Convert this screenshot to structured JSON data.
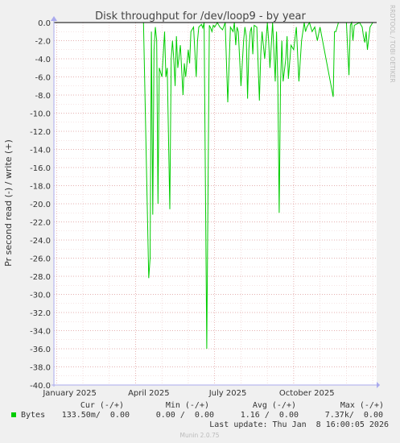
{
  "chart_data": {
    "type": "line",
    "title": "Disk throughput for /dev/loop9 - by year",
    "ylabel": "Pr second read (-) / write (+)",
    "side_label": "RRDTOOL / TOBI OETIKER",
    "ylim": [
      -40,
      0
    ],
    "y_ticks": [
      "0.0",
      "-2.0",
      "-4.0",
      "-6.0",
      "-8.0",
      "-10.0",
      "-12.0",
      "-14.0",
      "-16.0",
      "-18.0",
      "-20.0",
      "-22.0",
      "-24.0",
      "-26.0",
      "-28.0",
      "-30.0",
      "-32.0",
      "-34.0",
      "-36.0",
      "-38.0",
      "-40.0"
    ],
    "x_labels": [
      "January 2025",
      "April 2025",
      "July 2025",
      "October 2025"
    ],
    "series_color": "#00cc00",
    "series": [
      {
        "name": "Bytes",
        "x_months": [
          0.0,
          3.3,
          3.5,
          3.55,
          3.6,
          3.65,
          3.7,
          3.75,
          3.8,
          3.85,
          3.9,
          4.0,
          4.1,
          4.15,
          4.2,
          4.3,
          4.35,
          4.4,
          4.45,
          4.5,
          4.55,
          4.6,
          4.7,
          4.8,
          4.85,
          4.9,
          5.0,
          5.05,
          5.1,
          5.2,
          5.3,
          5.35,
          5.4,
          5.5,
          5.55,
          5.6,
          5.7,
          5.8,
          5.85,
          5.9,
          5.95,
          6.0,
          6.1,
          6.2,
          6.3,
          6.4,
          6.5,
          6.6,
          6.7,
          6.75,
          6.8,
          6.85,
          6.9,
          7.0,
          7.1,
          7.15,
          7.2,
          7.25,
          7.3,
          7.35,
          7.4,
          7.45,
          7.5,
          7.6,
          7.7,
          7.75,
          7.8,
          7.9,
          8.0,
          8.05,
          8.1,
          8.2,
          8.3,
          8.35,
          8.4,
          8.45,
          8.5,
          8.55,
          8.6,
          8.7,
          8.75,
          8.8,
          8.9,
          9.0,
          9.1,
          9.2,
          9.3,
          9.4,
          9.45,
          9.5,
          9.6,
          9.7,
          9.8,
          9.9,
          10.0,
          10.5,
          10.55,
          10.6,
          10.7,
          11.0,
          11.1,
          11.15,
          11.2,
          11.25,
          11.3,
          11.5,
          11.6,
          11.65,
          11.7,
          11.75,
          11.8,
          11.9,
          12.0
        ],
        "y": [
          0,
          0,
          -28.2,
          -26.0,
          -1.0,
          -21.2,
          -3.0,
          -0.5,
          -2.0,
          -20.0,
          -5.0,
          -6.0,
          -1.0,
          -6.0,
          -5.0,
          -20.6,
          -4.0,
          -2.0,
          -4.0,
          -7.0,
          -1.5,
          -5.0,
          -2.5,
          -8.0,
          -4.5,
          -6.0,
          -3.0,
          -4.5,
          -1.0,
          -0.5,
          -6.0,
          -2.0,
          -0.5,
          -0.2,
          -0.6,
          0,
          -36.0,
          -0.3,
          -0.6,
          -1.0,
          -0.3,
          -0.5,
          0,
          -0.5,
          -0.8,
          0,
          -8.8,
          -0.5,
          -1.0,
          0,
          -2.5,
          -0.5,
          -1.0,
          -7.0,
          -2.0,
          -0.5,
          -1.5,
          -8.4,
          -3.0,
          -1.0,
          -0.5,
          -3.5,
          -0.3,
          -0.5,
          -8.6,
          -3.5,
          -1.0,
          -4.0,
          0,
          -2.0,
          -5.0,
          0,
          -6.5,
          -1.0,
          -6.8,
          -21.0,
          -7.0,
          -2.0,
          -6.5,
          -4.0,
          -1.5,
          -6.2,
          -2.5,
          -3.0,
          -0.5,
          -6.5,
          -2.0,
          0,
          -1.0,
          -0.5,
          0,
          -1.0,
          -0.5,
          -2.0,
          -0.5,
          -8.2,
          -1.0,
          -1.0,
          0,
          0,
          -5.8,
          -0.3,
          0,
          -2.0,
          -0.3,
          0,
          -0.5,
          -1.5,
          -2.2,
          -1.0,
          -3.0,
          -0.5,
          0
        ]
      }
    ]
  },
  "legend": {
    "headers": [
      "Cur (-/+)",
      "Min (-/+)",
      "Avg (-/+)",
      "Max (-/+)"
    ],
    "rows": [
      {
        "name": "Bytes",
        "cur": "133.50m/  0.00",
        "min": "0.00 /  0.00",
        "avg": "1.16 /  0.00",
        "max": "7.37k/  0.00"
      }
    ]
  },
  "last_update": "Last update: Thu Jan  8 16:00:05 2026",
  "footer": "Munin 2.0.75"
}
